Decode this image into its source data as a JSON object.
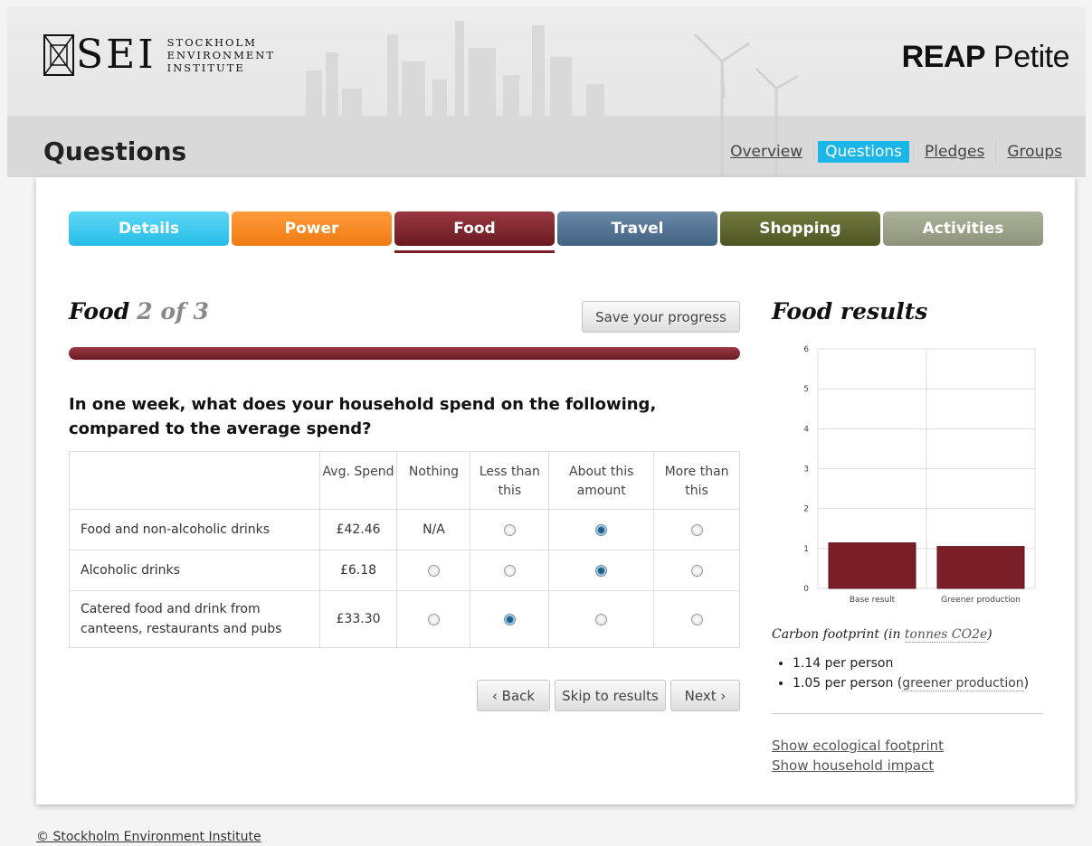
{
  "header": {
    "logo_letters": "SEI",
    "logo_name_lines": [
      "STOCKHOLM",
      "ENVIRONMENT",
      "INSTITUTE"
    ],
    "brand_bold": "REAP",
    "brand_rest": " Petite",
    "page_title": "Questions",
    "nav": [
      {
        "label": "Overview",
        "active": false
      },
      {
        "label": "Questions",
        "active": true
      },
      {
        "label": "Pledges",
        "active": false
      },
      {
        "label": "Groups",
        "active": false
      }
    ]
  },
  "tabs": [
    {
      "label": "Details"
    },
    {
      "label": "Power"
    },
    {
      "label": "Food",
      "active": true
    },
    {
      "label": "Travel"
    },
    {
      "label": "Shopping"
    },
    {
      "label": "Activities"
    }
  ],
  "section": {
    "title": "Food",
    "step": "2 of 3",
    "save_label": "Save your progress",
    "progress": 1.0
  },
  "question": "In one week, what does your household spend on the following, compared to the average spend?",
  "table": {
    "headers": [
      "",
      "Avg. Spend",
      "Nothing",
      "Less than this",
      "About this amount",
      "More than this"
    ],
    "rows": [
      {
        "item": "Food and non-alcoholic drinks",
        "avg": "£42.46",
        "nothing": "N/A",
        "selected": "about"
      },
      {
        "item": "Alcoholic drinks",
        "avg": "£6.18",
        "nothing": "",
        "selected": "about"
      },
      {
        "item": "Catered food and drink from canteens, restaurants and pubs",
        "avg": "£33.30",
        "nothing": "",
        "selected": "less"
      }
    ]
  },
  "buttons": {
    "back": "‹ Back",
    "skip": "Skip to results",
    "next": "Next ›"
  },
  "results": {
    "title": "Food results",
    "footprint_prefix": "Carbon footprint (in ",
    "footprint_link": "tonnes CO2e",
    "footprint_suffix": ")",
    "line1": "1.14 per person",
    "line2_prefix": "1.05 per person (",
    "line2_link": "greener production",
    "line2_suffix": ")",
    "link_ecological": "Show ecological footprint",
    "link_household": "Show household impact"
  },
  "chart_data": {
    "type": "bar",
    "categories": [
      "Base result",
      "Greener production"
    ],
    "values": [
      1.14,
      1.05
    ],
    "ylim": [
      0,
      6
    ],
    "yticks": [
      0,
      1,
      2,
      3,
      4,
      5,
      6
    ],
    "grid": true,
    "bar_color": "#7a1f28"
  },
  "footer": {
    "copyright": "© Stockholm Environment Institute"
  }
}
